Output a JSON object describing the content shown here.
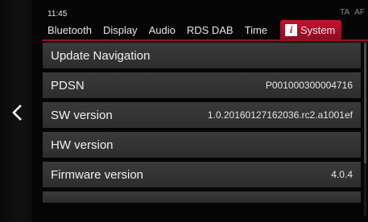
{
  "status": {
    "time": "11:45",
    "flags": [
      "TA",
      "AF"
    ]
  },
  "tabs": [
    {
      "label": "Bluetooth"
    },
    {
      "label": "Display"
    },
    {
      "label": "Audio"
    },
    {
      "label": "RDS DAB"
    },
    {
      "label": "Time"
    },
    {
      "label": "System",
      "icon": "info-icon",
      "icon_glyph": "i",
      "active": true
    }
  ],
  "rows": [
    {
      "label": "Update Navigation",
      "value": ""
    },
    {
      "label": "PDSN",
      "value": "P001000300004716"
    },
    {
      "label": "SW version",
      "value": "1.0.20160127162036.rc2.a1001ef"
    },
    {
      "label": "HW version",
      "value": ""
    },
    {
      "label": "Firmware version",
      "value": "4.0.4"
    }
  ],
  "colors": {
    "accent": "#a00c22",
    "row_background": "#333333",
    "text": "#f0f0f0"
  }
}
